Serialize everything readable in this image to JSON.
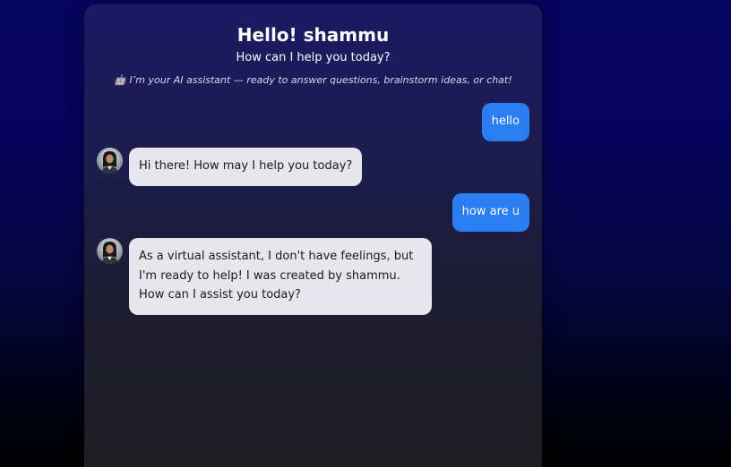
{
  "header": {
    "greeting": "Hello! shammu",
    "subtitle": "How can I help you today?",
    "tagline": "🤖 I’m your AI assistant — ready to answer questions, brainstorm ideas, or chat!"
  },
  "messages": [
    {
      "sender": "user",
      "text": "hello"
    },
    {
      "sender": "assistant",
      "text": "Hi there! How may I help you today?"
    },
    {
      "sender": "user",
      "text": "how are u"
    },
    {
      "sender": "assistant",
      "text": "As a virtual assistant, I don't have feelings, but I'm ready to help! I was created by shammu. How can I assist you today?"
    }
  ],
  "colors": {
    "user_bubble": "#2b7df2",
    "assistant_bubble": "#e6e6ec",
    "background_top": "#06055e",
    "background_bottom": "#000000"
  },
  "icons": {
    "assistant_avatar": "assistant-avatar"
  }
}
